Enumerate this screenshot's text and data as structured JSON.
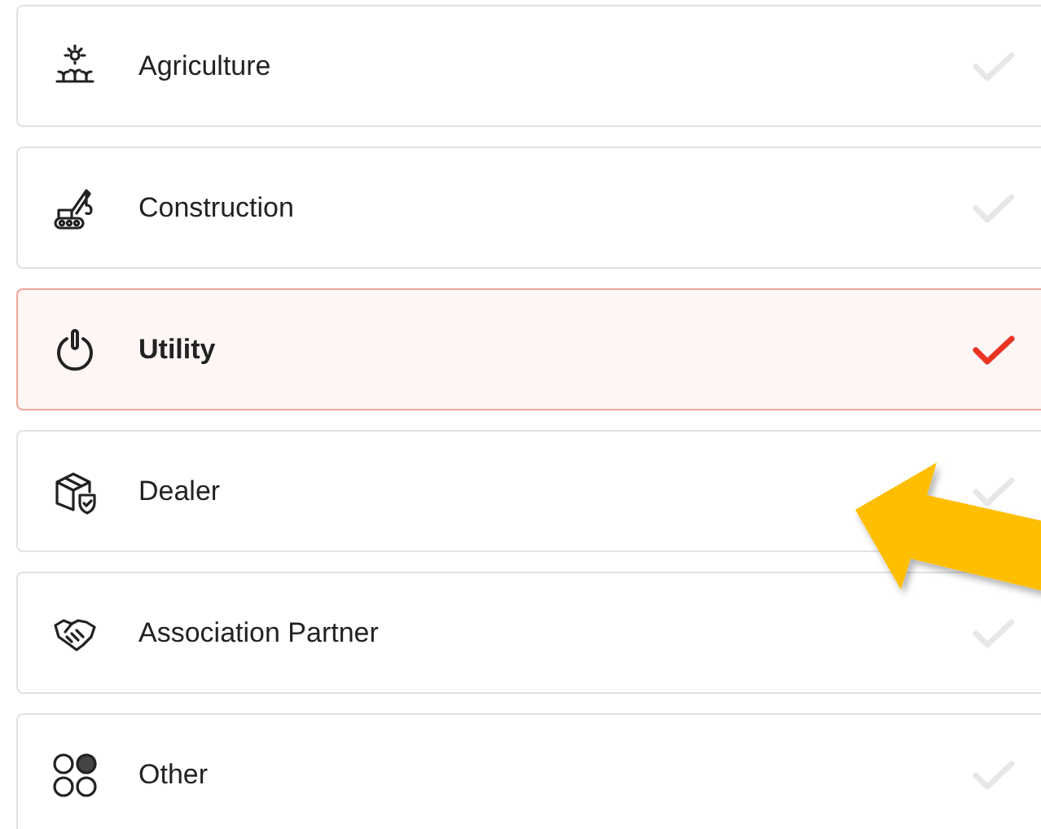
{
  "items": [
    {
      "kind": "agriculture",
      "label": "Agriculture",
      "selected": false
    },
    {
      "kind": "construction",
      "label": "Construction",
      "selected": false
    },
    {
      "kind": "utility",
      "label": "Utility",
      "selected": true
    },
    {
      "kind": "dealer",
      "label": "Dealer",
      "selected": false
    },
    {
      "kind": "partner",
      "label": "Association Partner",
      "selected": false
    },
    {
      "kind": "other",
      "label": "Other",
      "selected": false
    }
  ]
}
